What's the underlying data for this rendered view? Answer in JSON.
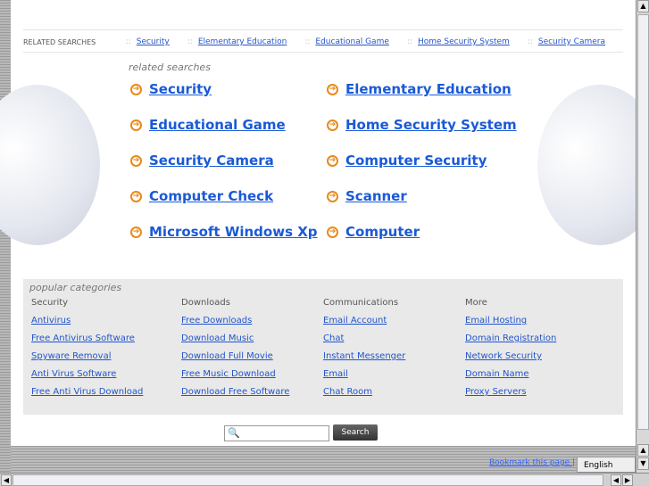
{
  "related_bar": {
    "label": "RELATED SEARCHES",
    "sep": "::",
    "links": [
      "Security",
      "Elementary Education",
      "Educational Game",
      "Home Security System",
      "Security Camera"
    ]
  },
  "related": {
    "heading": "related searches",
    "items": [
      "Security",
      "Elementary Education",
      "Educational Game",
      "Home Security System",
      "Security Camera",
      "Computer Security",
      "Computer Check",
      "Scanner",
      "Microsoft Windows Xp",
      "Computer"
    ]
  },
  "popular": {
    "title": "popular categories",
    "columns": [
      {
        "heading": "Security",
        "links": [
          "Antivirus",
          "Free Antivirus Software",
          "Spyware Removal",
          "Anti Virus Software",
          "Free Anti Virus Download"
        ]
      },
      {
        "heading": "Downloads",
        "links": [
          "Free Downloads",
          "Download Music",
          "Download Full Movie",
          "Free Music Download",
          "Download Free Software"
        ]
      },
      {
        "heading": "Communications",
        "links": [
          "Email Account",
          "Chat",
          "Instant Messenger",
          "Email",
          "Chat Room"
        ]
      },
      {
        "heading": "More",
        "links": [
          "Email Hosting",
          "Domain Registration",
          "Network Security",
          "Domain Name",
          "Proxy Servers"
        ]
      }
    ]
  },
  "search": {
    "button": "Search",
    "value": ""
  },
  "footer": {
    "bookmark": "Bookmark this page |",
    "language": "English"
  }
}
